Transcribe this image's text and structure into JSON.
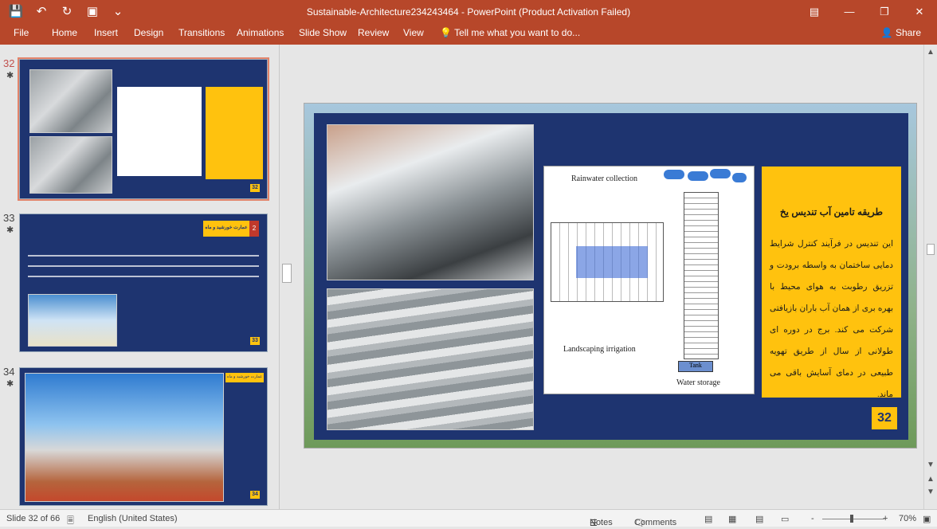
{
  "window": {
    "title": "Sustainable-Architecture234243464 - PowerPoint (Product Activation Failed)",
    "qat_icons": [
      "save-icon",
      "undo-icon",
      "redo-icon",
      "start-presentation-icon",
      "customize-icon"
    ],
    "controls": [
      "ribbon-display-icon",
      "minimize-icon",
      "maximize-icon",
      "close-icon"
    ]
  },
  "ribbon": {
    "tabs": [
      "File",
      "Home",
      "Insert",
      "Design",
      "Transitions",
      "Animations",
      "Slide Show",
      "Review",
      "View"
    ],
    "tell_me": "Tell me what you want to do...",
    "share": "Share"
  },
  "thumbnails": [
    {
      "number": "32",
      "selected": true,
      "badge": "32"
    },
    {
      "number": "33",
      "selected": false,
      "badge": "33",
      "heading_number": "2",
      "heading": "عمارت خورشید و ماه"
    },
    {
      "number": "34",
      "selected": false,
      "badge": "34",
      "heading": "عمارت خورشید و ماه"
    }
  ],
  "slide": {
    "diagram_labels": {
      "rainwater": "Rainwater collection",
      "irrigation": "Landscaping irrigation",
      "storage": "Water storage",
      "tank": "Tank"
    },
    "heading": "طریقه تامین آب تندیس یخ",
    "body": "این تندیس در فرآیند کنترل شرایط دمایی ساختمان به واسطه برودت و تزریق رطوبت به هوای محیط با بهره بری از همان آب باران بازیافتی شرکت می کند. برج در دوره ای طولانی از سال از طریق تهویه طبیعی در دمای آسایش باقی می ماند.",
    "number": "32"
  },
  "status": {
    "slide_of": "Slide 32 of 66",
    "language": "English (United States)",
    "notes": "Notes",
    "comments": "Comments",
    "zoom": "70%",
    "zoom_minus": "-",
    "zoom_plus": "+"
  },
  "colors": {
    "accent": "#b7472a",
    "slide_bg": "#1e3470",
    "highlight": "#ffc20e"
  }
}
